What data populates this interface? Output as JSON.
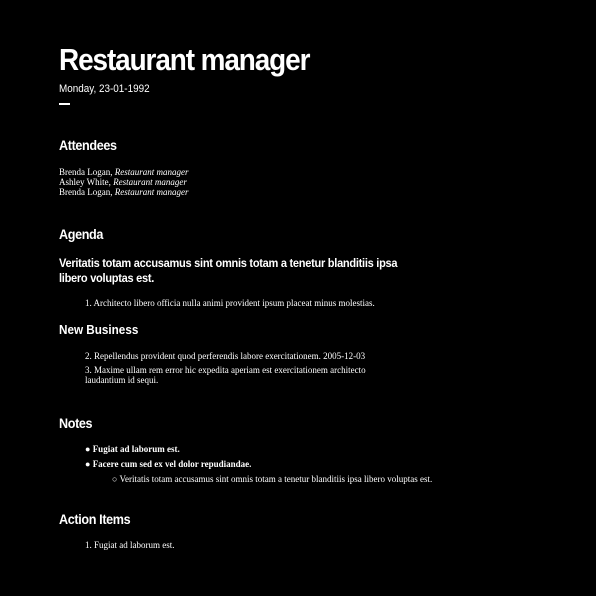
{
  "header": {
    "title": "Restaurant manager",
    "date": "Monday, 23-01-1992"
  },
  "attendees": {
    "heading": "Attendees",
    "people": [
      {
        "name": "Brenda Logan, ",
        "role": "Restaurant manager"
      },
      {
        "name": "Ashley White, ",
        "role": "Restaurant manager"
      },
      {
        "name": "Brenda Logan, ",
        "role": "Restaurant manager"
      }
    ]
  },
  "agenda": {
    "heading": "Agenda",
    "topic": "Veritatis totam accusamus sint omnis totam a tenetur blanditiis ipsa libero voluptas est.",
    "items": [
      {
        "num": "1.",
        "text": "Architecto libero officia nulla animi provident ipsum placeat minus molestias."
      }
    ],
    "new_business": {
      "heading": "New Business",
      "items": [
        {
          "num": "2.",
          "text": "Repellendus provident quod perferendis labore exercitationem. 2005-12-03"
        },
        {
          "num": "3.",
          "text": "Maxime ullam rem error hic expedita aperiam est exercitationem architecto laudantium id sequi."
        }
      ]
    }
  },
  "notes": {
    "heading": "Notes",
    "bullets": [
      {
        "marker": "●",
        "text": "Fugiat ad laborum est."
      },
      {
        "marker": "●",
        "text": "Facere cum sed ex vel dolor repudiandae."
      }
    ],
    "sub_bullets": [
      {
        "marker": "○",
        "text": "Veritatis totam accusamus sint omnis totam a tenetur blanditiis ipsa libero voluptas est."
      }
    ]
  },
  "action_items": {
    "heading": "Action Items",
    "items": [
      {
        "num": "1.",
        "text": "Fugiat ad laborum est."
      }
    ]
  }
}
